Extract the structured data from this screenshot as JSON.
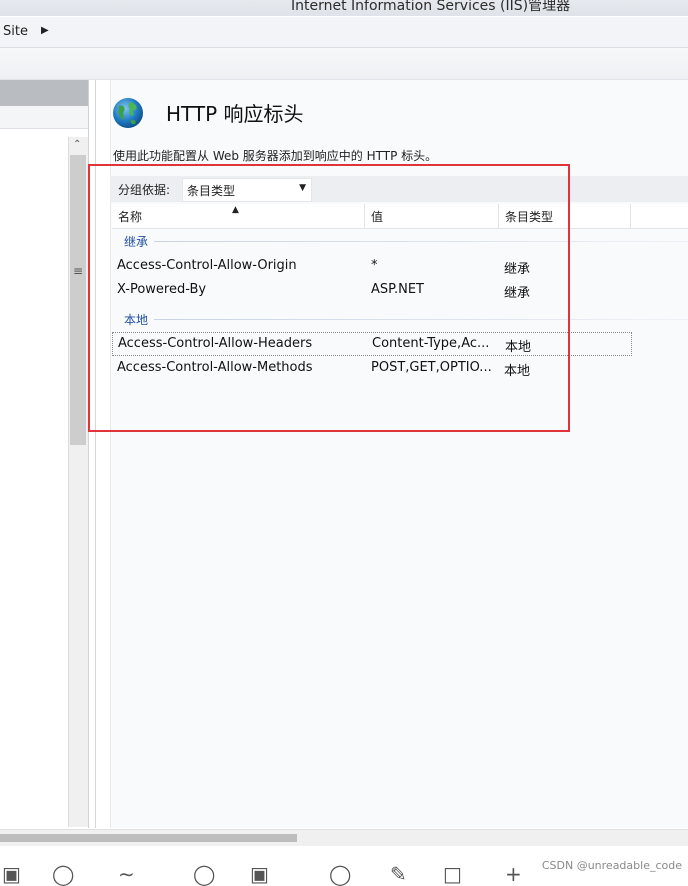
{
  "window": {
    "title": "Internet Information Services (IIS)管理器"
  },
  "breadcrumb": {
    "crumb_label": "Site",
    "chevron_icon": "chevron-right-icon"
  },
  "feature": {
    "icon": "globe-icon",
    "title": "HTTP 响应标头",
    "description": "使用此功能配置从 Web 服务器添加到响应中的 HTTP 标头。"
  },
  "groupby": {
    "label": "分组依据:",
    "selected": "条目类型"
  },
  "table": {
    "columns": [
      "名称",
      "值",
      "条目类型"
    ],
    "groups": [
      {
        "label": "继承",
        "rows": [
          {
            "name": "Access-Control-Allow-Origin",
            "value": "*",
            "type": "继承"
          },
          {
            "name": "X-Powered-By",
            "value": "ASP.NET",
            "type": "继承"
          }
        ]
      },
      {
        "label": "本地",
        "rows": [
          {
            "name": "Access-Control-Allow-Headers",
            "value": "Content-Type,Ac...",
            "type": "本地"
          },
          {
            "name": "Access-Control-Allow-Methods",
            "value": "POST,GET,OPTIO...",
            "type": "本地"
          }
        ]
      }
    ]
  },
  "watermark": "CSDN @unreadable_code",
  "colors": {
    "annotation_box": "#e0333a",
    "group_label": "#1f4fa3"
  }
}
